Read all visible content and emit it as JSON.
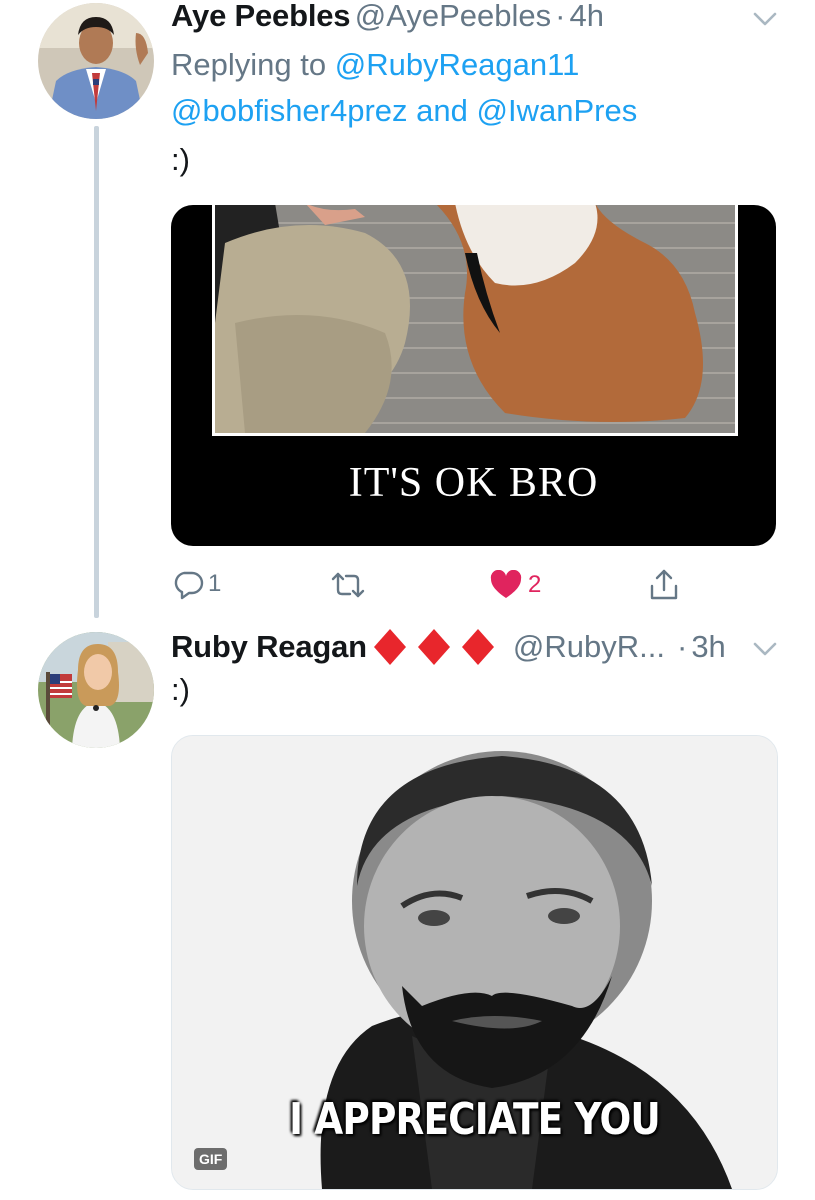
{
  "colors": {
    "accent": "#1da1f2",
    "muted": "#657786",
    "like": "#e0245e",
    "thread_line": "#c8d3dc"
  },
  "tweet1": {
    "author_name": "Aye Peebles",
    "author_handle": "@AyePeebles",
    "separator": "·",
    "time": "4h",
    "reply_prefix": "Replying to",
    "reply_to_1": "@RubyReagan11",
    "reply_to_2": "@bobfisher4prez",
    "reply_and": "and",
    "reply_to_3": "@IwanPres",
    "text": ":)",
    "media_caption": "IT'S OK BRO",
    "actions": {
      "reply_count": "1",
      "retweet_count": "",
      "like_count": "2",
      "reply_icon": "reply-icon",
      "retweet_icon": "retweet-icon",
      "like_icon": "heart-icon",
      "share_icon": "share-icon"
    }
  },
  "tweet2": {
    "author_name": "Ruby Reagan",
    "author_badges": [
      "diamond-icon",
      "diamond-icon",
      "diamond-icon"
    ],
    "author_handle": "@RubyR...",
    "separator": "·",
    "time": "3h",
    "text": ":)",
    "media_caption": "I APPRECIATE YOU",
    "media_badge": "GIF"
  }
}
